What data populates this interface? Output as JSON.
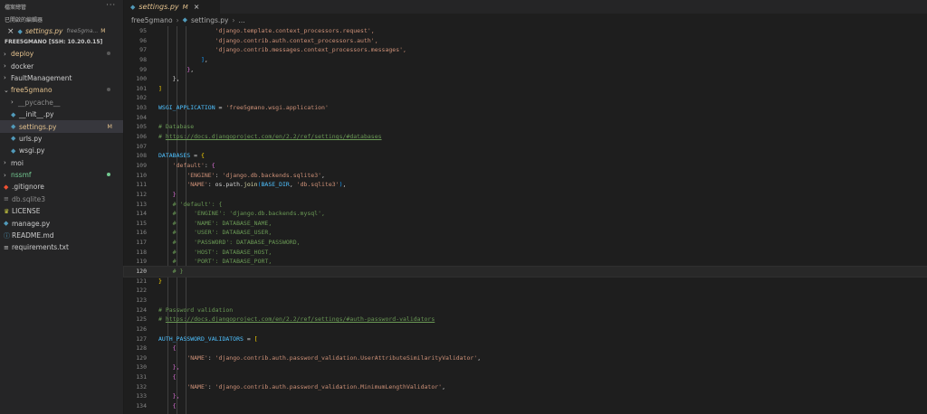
{
  "sidebar": {
    "explorer_title": "檔案總管",
    "more_icon": "ellipsis-icon",
    "open_editors_title": "已開啟的編輯器",
    "open_editor": {
      "name": "settings.py",
      "path": "free5gma...",
      "flag": "M"
    },
    "folder_title": "FREE5GMANO [SSH: 10.20.0.15]",
    "items": [
      {
        "label": "deploy",
        "type": "folder",
        "open": false,
        "color": "#e2c08d",
        "indicator": "dot",
        "indicator_color": "#5a5a5a"
      },
      {
        "label": "docker",
        "type": "folder",
        "open": false,
        "color": "#cccccc",
        "indicator": "",
        "indicator_color": ""
      },
      {
        "label": "FaultManagement",
        "type": "folder",
        "open": false,
        "color": "#cccccc",
        "indicator": "",
        "indicator_color": ""
      },
      {
        "label": "free5gmano",
        "type": "folder",
        "open": true,
        "color": "#e2c08d",
        "indicator": "dot",
        "indicator_color": "#5a5a5a"
      },
      {
        "label": "__pycache__",
        "type": "folder",
        "open": false,
        "color": "#8c8c8c",
        "indicator": "",
        "indicator_color": ""
      },
      {
        "label": "__init__.py",
        "type": "python",
        "open": false,
        "color": "#cccccc",
        "indicator": "",
        "indicator_color": ""
      },
      {
        "label": "settings.py",
        "type": "python",
        "open": false,
        "color": "#e2c08d",
        "indicator": "M",
        "indicator_color": "#e2c08d",
        "selected": true
      },
      {
        "label": "urls.py",
        "type": "python",
        "open": false,
        "color": "#cccccc",
        "indicator": "",
        "indicator_color": ""
      },
      {
        "label": "wsgi.py",
        "type": "python",
        "open": false,
        "color": "#cccccc",
        "indicator": "",
        "indicator_color": ""
      },
      {
        "label": "moi",
        "type": "folder",
        "open": false,
        "color": "#cccccc",
        "indicator": "",
        "indicator_color": ""
      },
      {
        "label": "nssmf",
        "type": "folder",
        "open": false,
        "color": "#73c991",
        "indicator": "dot",
        "indicator_color": "#73c991"
      },
      {
        "label": ".gitignore",
        "type": "git",
        "open": false,
        "color": "#cccccc",
        "indicator": "",
        "indicator_color": ""
      },
      {
        "label": "db.sqlite3",
        "type": "db",
        "open": false,
        "color": "#8c8c8c",
        "indicator": "",
        "indicator_color": ""
      },
      {
        "label": "LICENSE",
        "type": "license",
        "open": false,
        "color": "#cccccc",
        "indicator": "",
        "indicator_color": ""
      },
      {
        "label": "manage.py",
        "type": "python",
        "open": false,
        "color": "#cccccc",
        "indicator": "",
        "indicator_color": ""
      },
      {
        "label": "README.md",
        "type": "info",
        "open": false,
        "color": "#cccccc",
        "indicator": "",
        "indicator_color": ""
      },
      {
        "label": "requirements.txt",
        "type": "text",
        "open": false,
        "color": "#cccccc",
        "indicator": "",
        "indicator_color": ""
      }
    ]
  },
  "tab": {
    "label": "settings.py",
    "modified": "M",
    "close_icon": "close-icon"
  },
  "breadcrumb": {
    "folder": "free5gmano",
    "file": "settings.py",
    "symbol": "..."
  },
  "editor": {
    "current_line": 120,
    "lines": [
      {
        "n": 95,
        "t": [
          [
            "                'django.template.context_processors.request',",
            "c-str"
          ]
        ]
      },
      {
        "n": 96,
        "t": [
          [
            "                'django.contrib.auth.context_processors.auth',",
            "c-str"
          ]
        ]
      },
      {
        "n": 97,
        "t": [
          [
            "                'django.contrib.messages.context_processors.messages',",
            "c-str"
          ]
        ]
      },
      {
        "n": 98,
        "t": [
          [
            "            ",
            ""
          ],
          [
            "]",
            "c-br3"
          ],
          [
            ",",
            "c-pun"
          ]
        ]
      },
      {
        "n": 99,
        "t": [
          [
            "        ",
            ""
          ],
          [
            "}",
            "c-br2"
          ],
          [
            ",",
            "c-pun"
          ]
        ]
      },
      {
        "n": 100,
        "t": [
          [
            "    ",
            ""
          ],
          [
            "},",
            "c-pun"
          ]
        ]
      },
      {
        "n": 101,
        "t": [
          [
            "]",
            "c-br1"
          ]
        ]
      },
      {
        "n": 102,
        "t": []
      },
      {
        "n": 103,
        "t": [
          [
            "WSGI_APPLICATION",
            "c-var"
          ],
          [
            " = ",
            "c-pun"
          ],
          [
            "'free5gmano.wsgi.application'",
            "c-str"
          ]
        ]
      },
      {
        "n": 104,
        "t": []
      },
      {
        "n": 105,
        "t": [
          [
            "# Database",
            "c-cmt"
          ]
        ]
      },
      {
        "n": 106,
        "t": [
          [
            "# ",
            "c-cmt"
          ],
          [
            "https://docs.djangoproject.com/en/2.2/ref/settings/#databases",
            "c-link"
          ]
        ]
      },
      {
        "n": 107,
        "t": []
      },
      {
        "n": 108,
        "t": [
          [
            "DATABASES",
            "c-var"
          ],
          [
            " = ",
            "c-pun"
          ],
          [
            "{",
            "c-br1"
          ]
        ]
      },
      {
        "n": 109,
        "t": [
          [
            "    ",
            ""
          ],
          [
            "'default'",
            "c-str"
          ],
          [
            ": ",
            "c-pun"
          ],
          [
            "{",
            "c-br2"
          ]
        ]
      },
      {
        "n": 110,
        "t": [
          [
            "        ",
            ""
          ],
          [
            "'ENGINE'",
            "c-str"
          ],
          [
            ": ",
            "c-pun"
          ],
          [
            "'django.db.backends.sqlite3'",
            "c-str"
          ],
          [
            ",",
            "c-pun"
          ]
        ]
      },
      {
        "n": 111,
        "t": [
          [
            "        ",
            ""
          ],
          [
            "'NAME'",
            "c-str"
          ],
          [
            ": ",
            "c-pun"
          ],
          [
            "os",
            "c-pun"
          ],
          [
            ".path.",
            "c-pun"
          ],
          [
            "join",
            "c-fn"
          ],
          [
            "(",
            "c-br3"
          ],
          [
            "BASE_DIR",
            "c-var"
          ],
          [
            ", ",
            "c-pun"
          ],
          [
            "'db.sqlite3'",
            "c-str"
          ],
          [
            ")",
            "c-br3"
          ],
          [
            ",",
            "c-pun"
          ]
        ]
      },
      {
        "n": 112,
        "t": [
          [
            "    ",
            ""
          ],
          [
            "}",
            "c-br2"
          ]
        ]
      },
      {
        "n": 113,
        "t": [
          [
            "    # 'default': {",
            "c-cmt"
          ]
        ]
      },
      {
        "n": 114,
        "t": [
          [
            "    #     'ENGINE': 'django.db.backends.mysql',",
            "c-cmt"
          ]
        ]
      },
      {
        "n": 115,
        "t": [
          [
            "    #     'NAME': DATABASE_NAME,",
            "c-cmt"
          ]
        ]
      },
      {
        "n": 116,
        "t": [
          [
            "    #     'USER': DATABASE_USER,",
            "c-cmt"
          ]
        ]
      },
      {
        "n": 117,
        "t": [
          [
            "    #     'PASSWORD': DATABASE_PASSWORD,",
            "c-cmt"
          ]
        ]
      },
      {
        "n": 118,
        "t": [
          [
            "    #     'HOST': DATABASE_HOST,",
            "c-cmt"
          ]
        ]
      },
      {
        "n": 119,
        "t": [
          [
            "    #     'PORT': DATABASE_PORT,",
            "c-cmt"
          ]
        ]
      },
      {
        "n": 120,
        "t": [
          [
            "    # }",
            "c-cmt"
          ]
        ]
      },
      {
        "n": 121,
        "t": [
          [
            "}",
            "c-br1"
          ]
        ]
      },
      {
        "n": 122,
        "t": []
      },
      {
        "n": 123,
        "t": []
      },
      {
        "n": 124,
        "t": [
          [
            "# Password validation",
            "c-cmt"
          ]
        ]
      },
      {
        "n": 125,
        "t": [
          [
            "# ",
            "c-cmt"
          ],
          [
            "https://docs.djangoproject.com/en/2.2/ref/settings/#auth-password-validators",
            "c-link"
          ]
        ]
      },
      {
        "n": 126,
        "t": []
      },
      {
        "n": 127,
        "t": [
          [
            "AUTH_PASSWORD_VALIDATORS",
            "c-var"
          ],
          [
            " = ",
            "c-pun"
          ],
          [
            "[",
            "c-br1"
          ]
        ]
      },
      {
        "n": 128,
        "t": [
          [
            "    ",
            ""
          ],
          [
            "{",
            "c-br2"
          ]
        ]
      },
      {
        "n": 129,
        "t": [
          [
            "        ",
            ""
          ],
          [
            "'NAME'",
            "c-str"
          ],
          [
            ": ",
            "c-pun"
          ],
          [
            "'django.contrib.auth.password_validation.UserAttributeSimilarityValidator'",
            "c-str"
          ],
          [
            ",",
            "c-pun"
          ]
        ]
      },
      {
        "n": 130,
        "t": [
          [
            "    ",
            ""
          ],
          [
            "},",
            "c-br2"
          ]
        ]
      },
      {
        "n": 131,
        "t": [
          [
            "    ",
            ""
          ],
          [
            "{",
            "c-br2"
          ]
        ]
      },
      {
        "n": 132,
        "t": [
          [
            "        ",
            ""
          ],
          [
            "'NAME'",
            "c-str"
          ],
          [
            ": ",
            "c-pun"
          ],
          [
            "'django.contrib.auth.password_validation.MinimumLengthValidator'",
            "c-str"
          ],
          [
            ",",
            "c-pun"
          ]
        ]
      },
      {
        "n": 133,
        "t": [
          [
            "    ",
            ""
          ],
          [
            "},",
            "c-br2"
          ]
        ]
      },
      {
        "n": 134,
        "t": [
          [
            "    ",
            ""
          ],
          [
            "{",
            "c-br2"
          ]
        ]
      }
    ]
  }
}
